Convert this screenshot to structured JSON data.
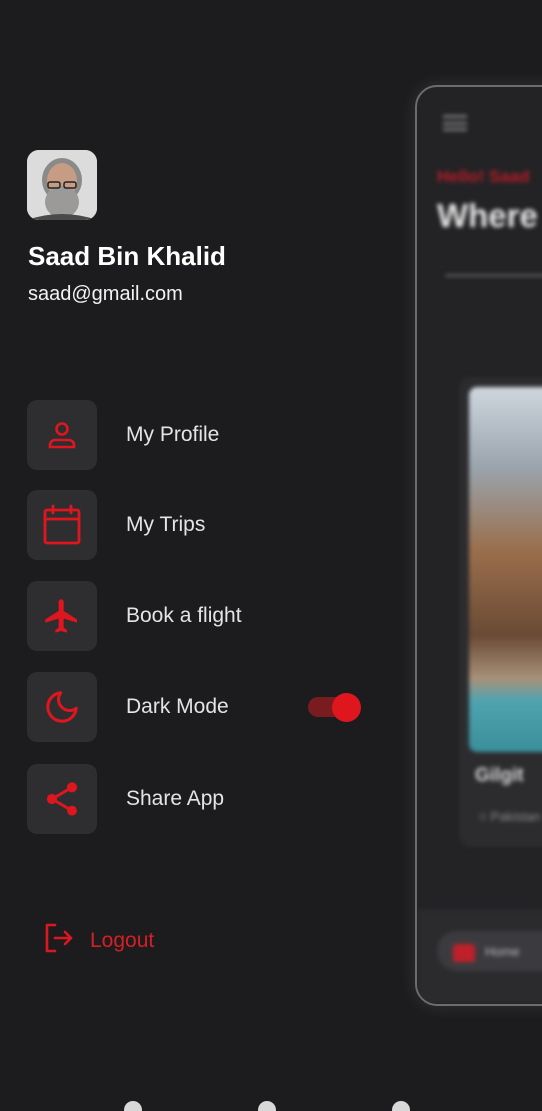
{
  "colors": {
    "accent": "#e0161f",
    "background": "#1c1c1e",
    "icon_box": "#2e2e30"
  },
  "user": {
    "name": "Saad Bin Khalid",
    "email": "saad@gmail.com"
  },
  "menu": [
    {
      "label": "My Profile",
      "icon": "person-icon"
    },
    {
      "label": "My Trips",
      "icon": "calendar-icon"
    },
    {
      "label": "Book a flight",
      "icon": "airplane-icon"
    },
    {
      "label": "Dark Mode",
      "icon": "moon-icon",
      "toggle": true
    },
    {
      "label": "Share App",
      "icon": "share-icon"
    }
  ],
  "logout": {
    "label": "Logout",
    "icon": "logout-icon"
  },
  "preview": {
    "greeting": "Hello! Saad",
    "heading": "Where",
    "place": "Gilgit",
    "region": "Pakistan",
    "nav_home": "Home"
  }
}
